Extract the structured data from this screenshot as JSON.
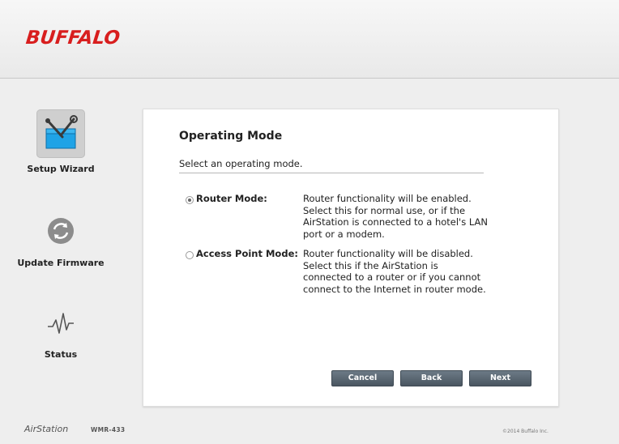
{
  "brand": {
    "logo_text": "BUFFALO"
  },
  "sidebar": {
    "items": [
      {
        "label": "Setup Wizard",
        "icon": "toolbox-wrench-icon",
        "active": true
      },
      {
        "label": "Update Firmware",
        "icon": "refresh-icon",
        "active": false
      },
      {
        "label": "Status",
        "icon": "pulse-icon",
        "active": false
      }
    ]
  },
  "main": {
    "title": "Operating Mode",
    "subtitle": "Select an operating mode.",
    "options": [
      {
        "label": "Router Mode:",
        "selected": true,
        "description": "Router functionality will be enabled. Select this for normal use, or if the AirStation is connected to a hotel's LAN port or a modem."
      },
      {
        "label": "Access Point Mode:",
        "selected": false,
        "description": "Router functionality will be disabled. Select this if the AirStation is connected to a router or if you cannot connect to the Internet in router mode."
      }
    ],
    "buttons": {
      "cancel": "Cancel",
      "back": "Back",
      "next": "Next"
    }
  },
  "footer": {
    "brand": "AirStation",
    "model": "WMR-433",
    "copyright": "©2014 Buffalo Inc."
  },
  "colors": {
    "brand_red": "#d81e1e",
    "button_gray": "#55606b",
    "icon_blue": "#1fa3e6"
  }
}
